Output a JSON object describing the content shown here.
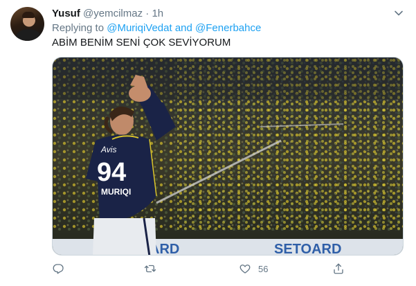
{
  "tweet": {
    "name": "Yusuf",
    "handle": "@yemcilmaz",
    "separator": "·",
    "time": "1h",
    "replying_prefix": "Replying to",
    "replying_to_1": "@MuriqiVedat",
    "replying_and": "and",
    "replying_to_2": "@Fenerbahce",
    "text": "ABİM BENİM SENİ ÇOK SEVİYORUM",
    "media": {
      "jersey_number": "94",
      "jersey_name": "MURIQI",
      "sponsor_text": "Avis",
      "board_text_left": "ARD",
      "board_text_right": "SETOARD"
    }
  },
  "actions": {
    "reply_icon": "reply-icon",
    "retweet_icon": "retweet-icon",
    "like_icon": "heart-icon",
    "like_count": "56",
    "share_icon": "share-icon"
  },
  "colors": {
    "accent": "#1da1f2",
    "secondary_text": "#657786",
    "primary_text": "#14171a",
    "jersey_navy": "#1a2347",
    "crowd_yellow": "#d8c32a"
  }
}
